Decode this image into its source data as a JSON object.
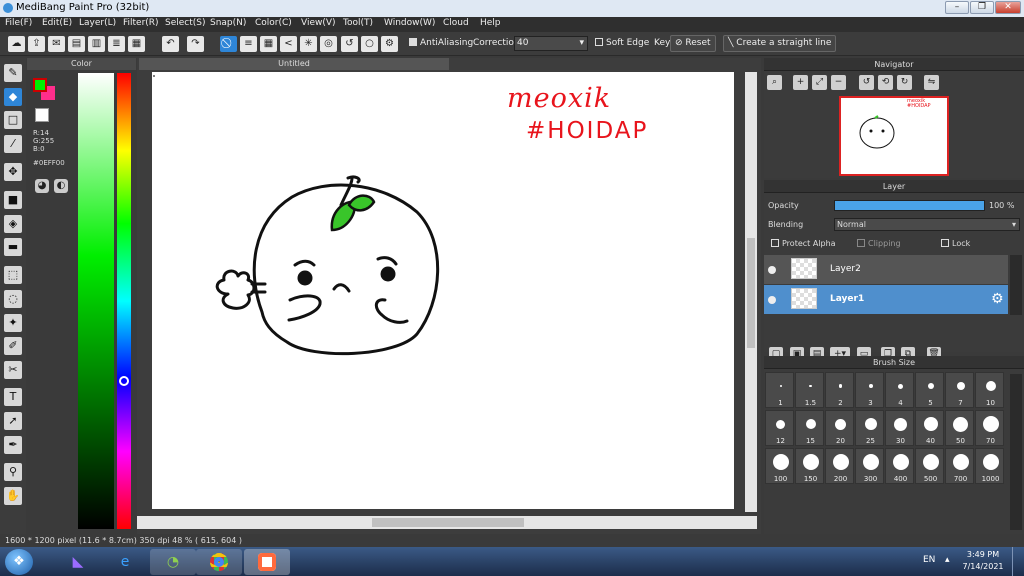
{
  "window": {
    "title": "MediBang Paint Pro (32bit)",
    "minimize": "–",
    "maximize": "❐",
    "close": "✕"
  },
  "menu": [
    "File(F)",
    "Edit(E)",
    "Layer(L)",
    "Filter(R)",
    "Select(S)",
    "Snap(N)",
    "Color(C)",
    "View(V)",
    "Tool(T)",
    "Window(W)",
    "Cloud",
    "Help"
  ],
  "toolbar": {
    "antialiasing_label": "AntiAliasing",
    "correction_label": "Correction",
    "correction_value": "40",
    "soft_edge_label": "Soft Edge",
    "key_label": "Key",
    "reset_label": "Reset",
    "straight_line_label": "Create a straight line"
  },
  "color_panel": {
    "title": "Color",
    "foreground": "#00EF00",
    "background": "#FF2E8C",
    "r": "R:14",
    "g": "G:255",
    "b": "B:0",
    "hex": "#0EFF00"
  },
  "canvas": {
    "tab_title": "Untitled",
    "annotation_line1": "meoxik",
    "annotation_line2": "#HOIDAP",
    "annotation_color": "#e8141c"
  },
  "navigator": {
    "title": "Navigator",
    "mini_line1": "meoxik",
    "mini_line2": "#HOIDAP"
  },
  "layer_panel": {
    "title": "Layer",
    "opacity_label": "Opacity",
    "opacity_value": "100 %",
    "opacity": 1.0,
    "blending_label": "Blending",
    "blending_value": "Normal",
    "protect_alpha": "Protect Alpha",
    "clipping": "Clipping",
    "lock": "Lock",
    "layers": [
      {
        "name": "Layer2",
        "selected": false
      },
      {
        "name": "Layer1",
        "selected": true
      }
    ]
  },
  "brush_size": {
    "title": "Brush Size",
    "sizes": [
      "1",
      "1.5",
      "2",
      "3",
      "4",
      "5",
      "7",
      "10",
      "12",
      "15",
      "20",
      "25",
      "30",
      "40",
      "50",
      "70",
      "100",
      "150",
      "200",
      "300",
      "400",
      "500",
      "700",
      "1000"
    ]
  },
  "status": {
    "text": "1600 * 1200 pixel   (11.6 * 8.7cm)   350 dpi   48 %   ( 615, 604 )"
  },
  "taskbar": {
    "lang": "EN",
    "time": "3:49 PM",
    "date": "7/14/2021"
  }
}
